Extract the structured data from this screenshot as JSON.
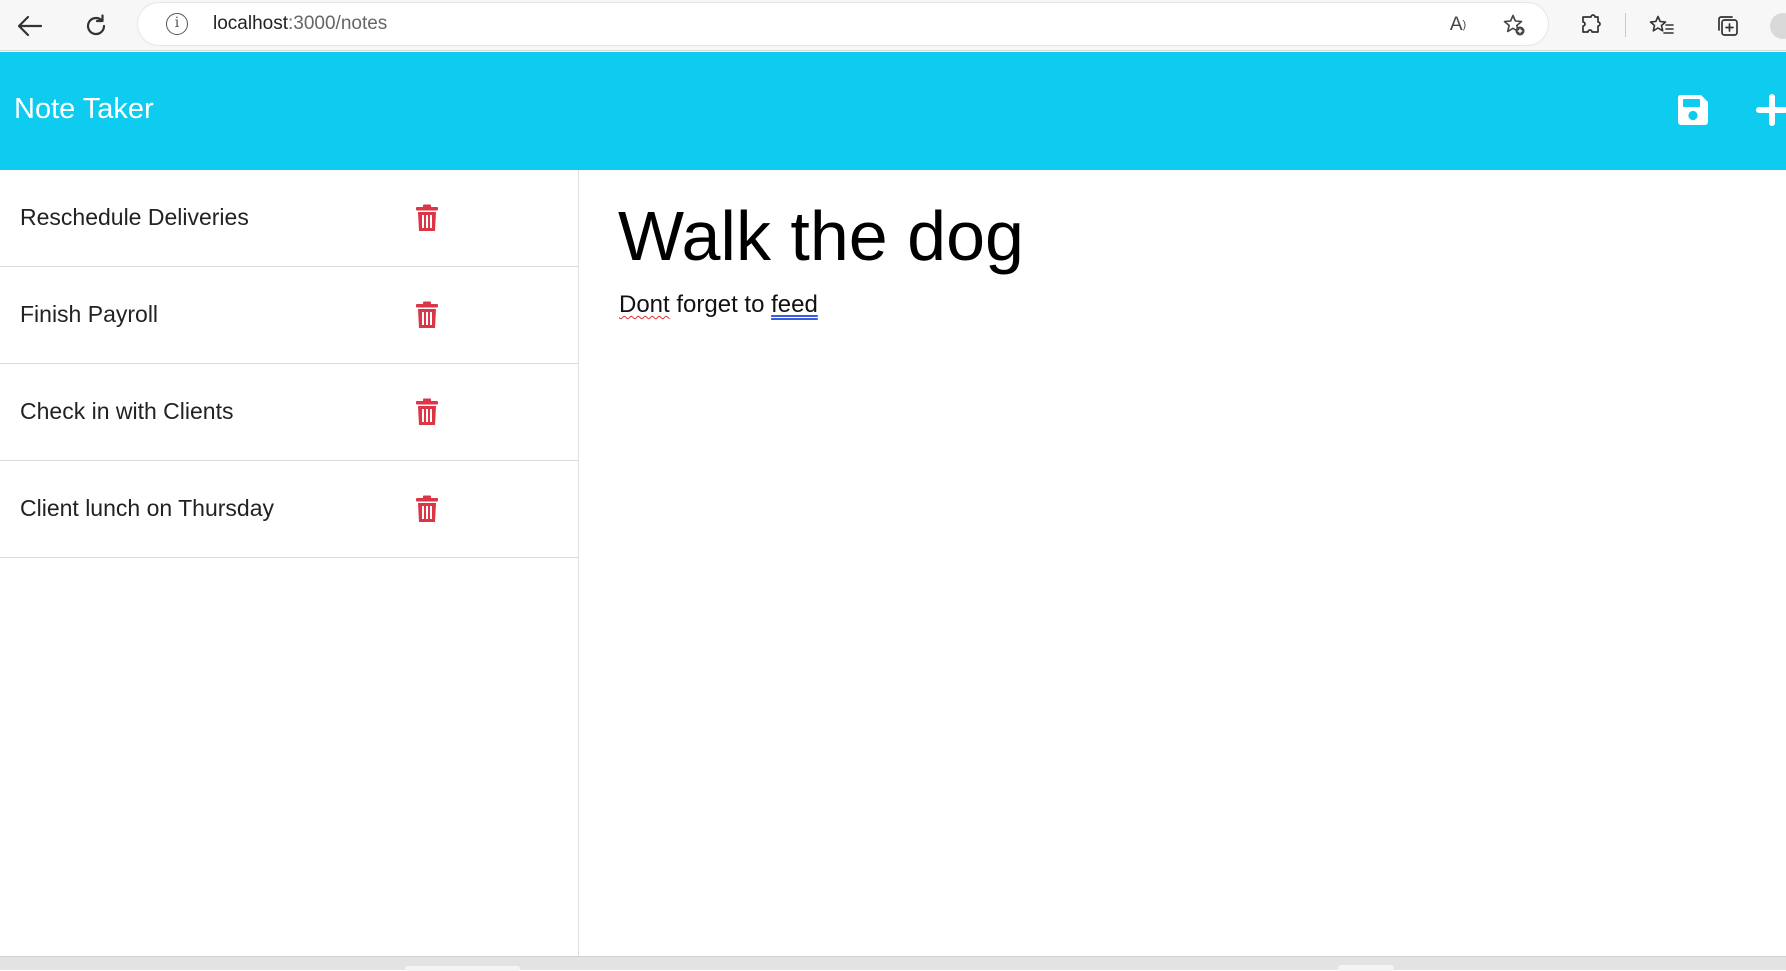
{
  "browser": {
    "url_host": "localhost",
    "url_path": ":3000/notes",
    "icons": [
      "back-icon",
      "reload-icon",
      "info-icon",
      "read-aloud-icon",
      "add-favorite-icon",
      "extensions-icon",
      "favorites-icon",
      "collections-icon",
      "profile-icon"
    ]
  },
  "header": {
    "title": "Note Taker",
    "accent_color": "#0ecbf0",
    "icons": [
      "save-icon",
      "plus-icon"
    ]
  },
  "sidebar": {
    "notes": [
      {
        "title": "Reschedule Deliveries"
      },
      {
        "title": "Finish Payroll"
      },
      {
        "title": "Check in with Clients"
      },
      {
        "title": "Client lunch on Thursday"
      }
    ],
    "delete_icon": "trash-icon",
    "delete_color": "#dc3545"
  },
  "editor": {
    "note_title": "Walk the dog",
    "note_text_parts": [
      "Dont",
      " forget to ",
      "feed"
    ]
  }
}
